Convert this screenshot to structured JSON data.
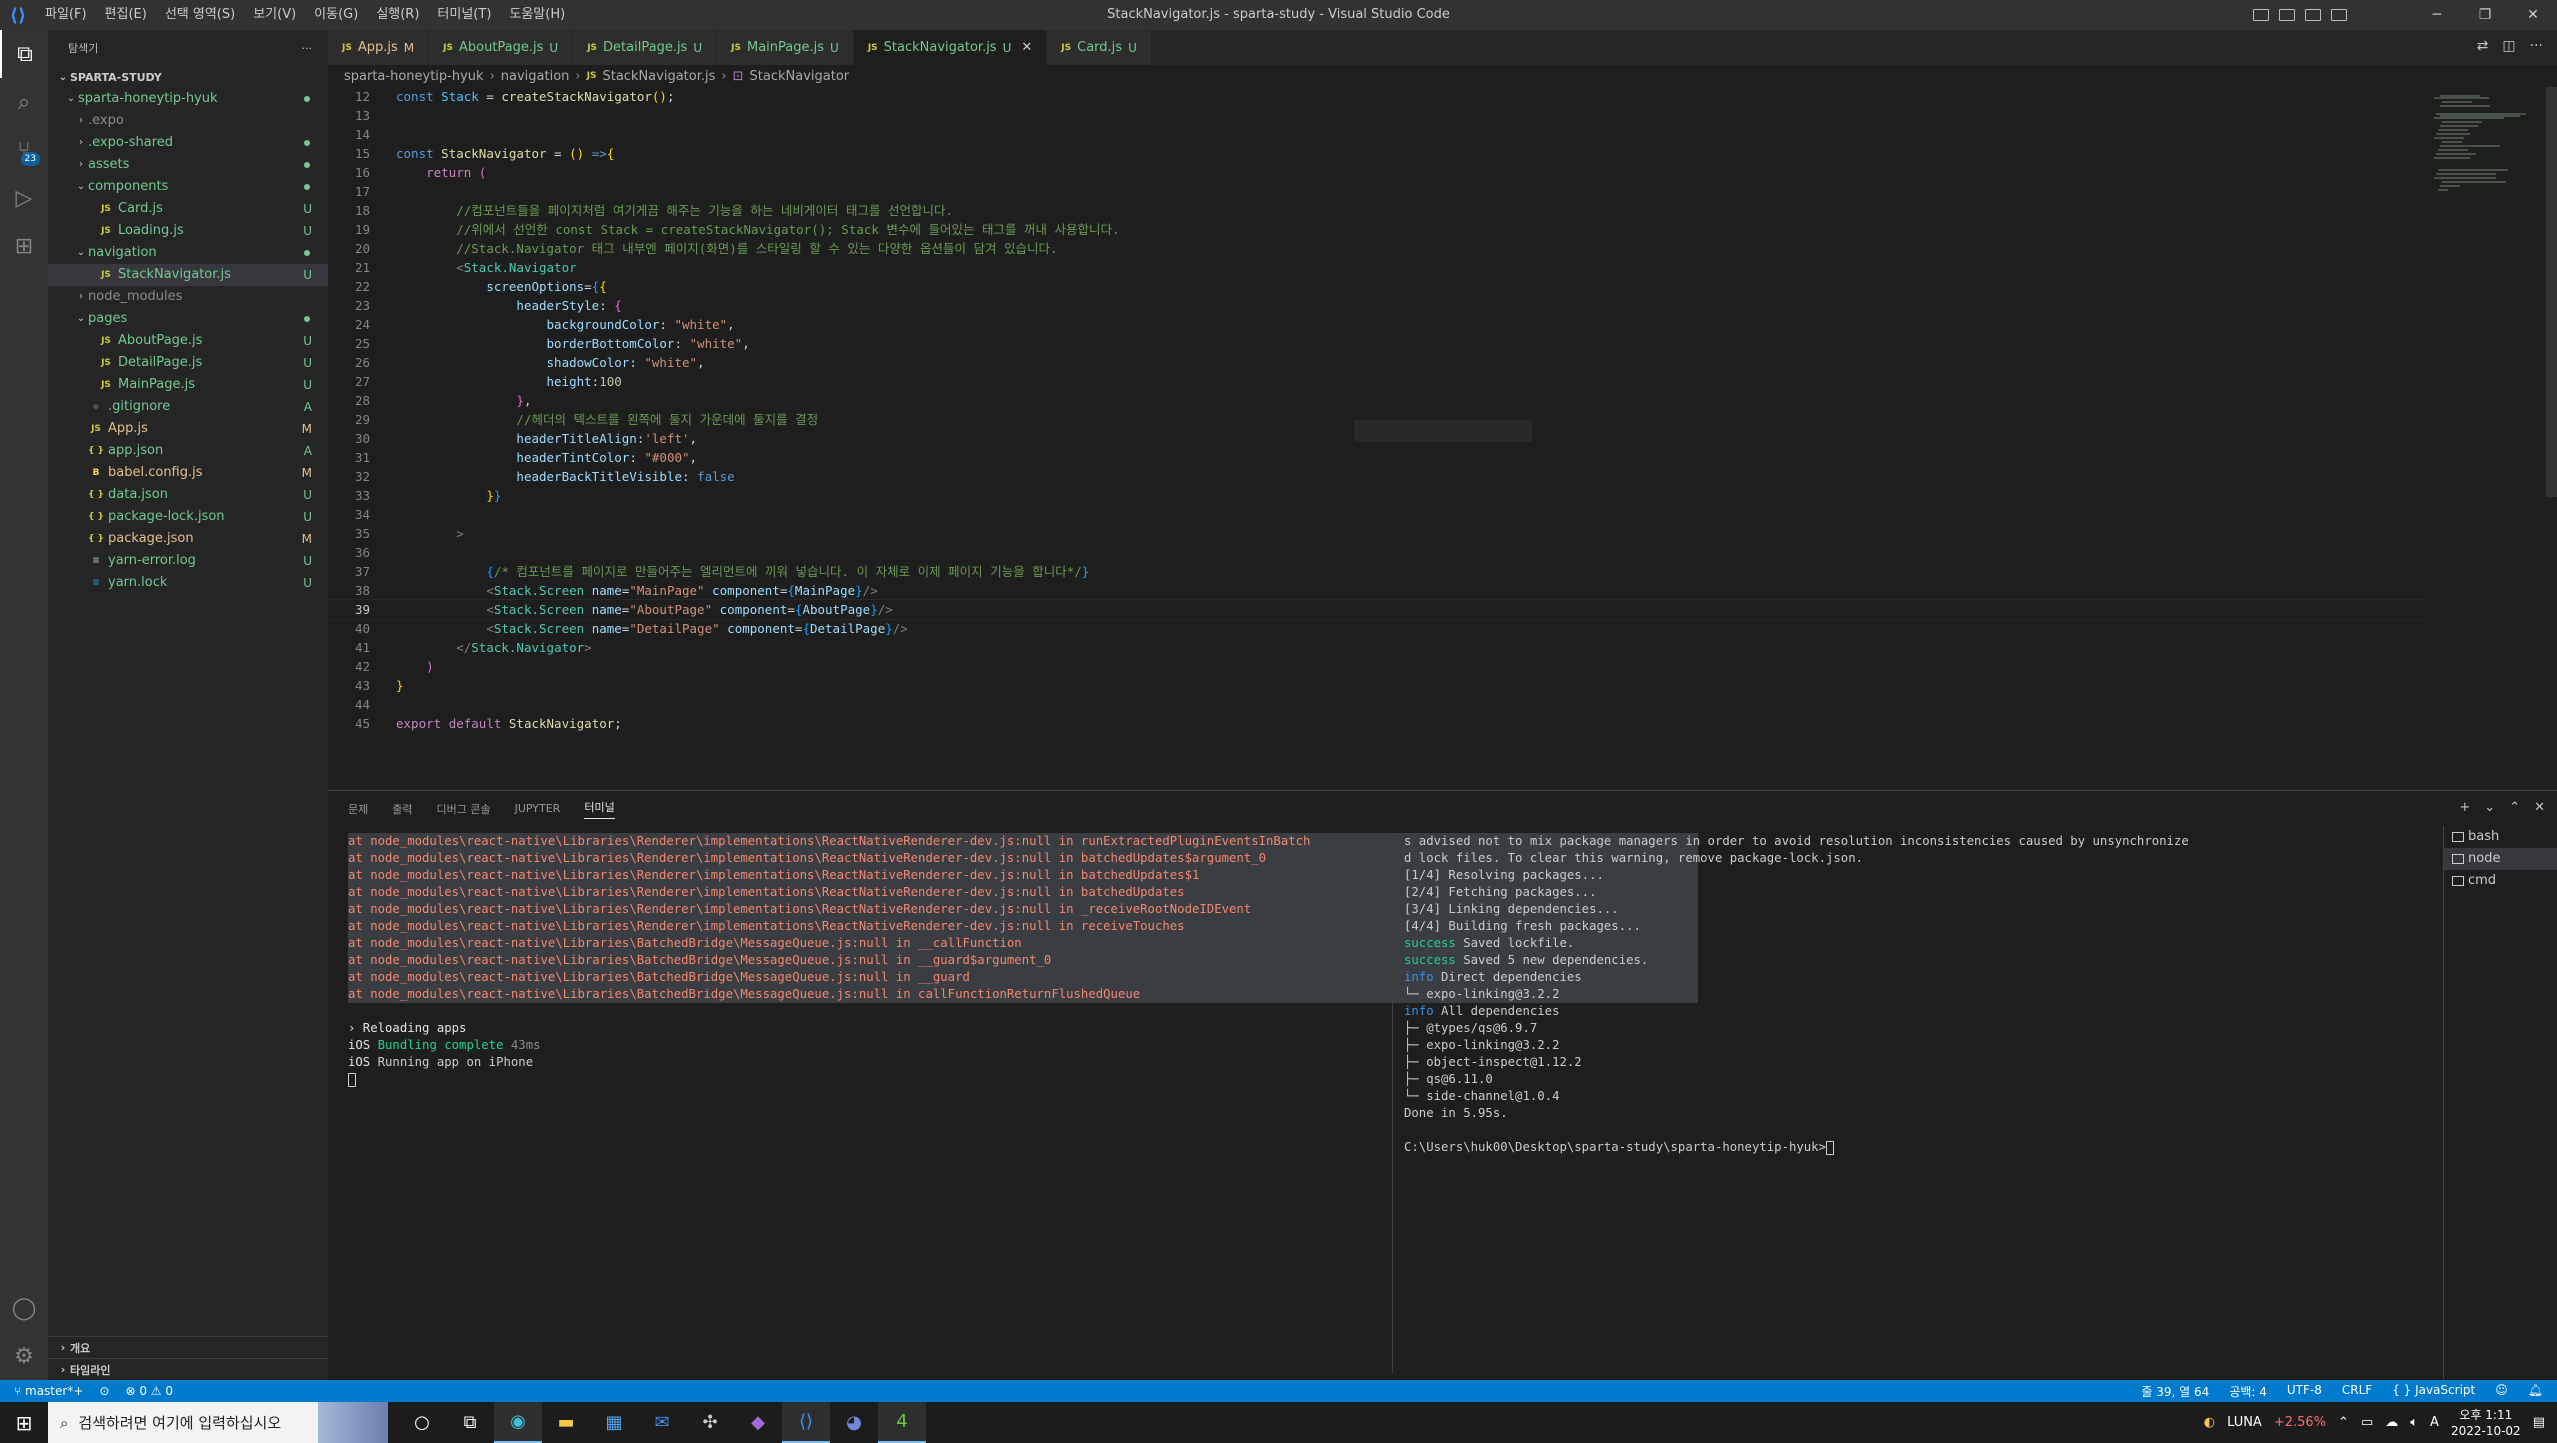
{
  "window": {
    "title": "StackNavigator.js - sparta-study - Visual Studio Code",
    "menu": [
      "파일(F)",
      "편집(E)",
      "선택 영역(S)",
      "보기(V)",
      "이동(G)",
      "실행(R)",
      "터미널(T)",
      "도움말(H)"
    ],
    "controls": {
      "minimize": "─",
      "maximize": "❐",
      "close": "✕"
    }
  },
  "activity_bar": {
    "scm_badge": "23"
  },
  "explorer": {
    "header": "탐색기",
    "more": "···",
    "root": "SPARTA-STUDY",
    "items": [
      {
        "label": "sparta-honeytip-hyuk",
        "chev": "⌄",
        "indent": 1,
        "color": "#73c991",
        "deco": "dot",
        "type": "folder"
      },
      {
        "label": ".expo",
        "chev": "›",
        "indent": 2,
        "color": "#8c8c8c",
        "deco": "",
        "type": "folder"
      },
      {
        "label": ".expo-shared",
        "chev": "›",
        "indent": 2,
        "color": "#73c991",
        "deco": "dot",
        "type": "folder"
      },
      {
        "label": "assets",
        "chev": "›",
        "indent": 2,
        "color": "#73c991",
        "deco": "dot",
        "type": "folder"
      },
      {
        "label": "components",
        "chev": "⌄",
        "indent": 2,
        "color": "#73c991",
        "deco": "dot",
        "type": "folder"
      },
      {
        "label": "Card.js",
        "chev": "",
        "indent": 3,
        "color": "#73c991",
        "deco": "U",
        "type": "js"
      },
      {
        "label": "Loading.js",
        "chev": "",
        "indent": 3,
        "color": "#73c991",
        "deco": "U",
        "type": "js"
      },
      {
        "label": "navigation",
        "chev": "⌄",
        "indent": 2,
        "color": "#73c991",
        "deco": "dot",
        "type": "folder"
      },
      {
        "label": "StackNavigator.js",
        "chev": "",
        "indent": 3,
        "color": "#73c991",
        "deco": "U",
        "type": "js",
        "selected": true
      },
      {
        "label": "node_modules",
        "chev": "›",
        "indent": 2,
        "color": "#8c8c8c",
        "deco": "",
        "type": "folder"
      },
      {
        "label": "pages",
        "chev": "⌄",
        "indent": 2,
        "color": "#73c991",
        "deco": "dot",
        "type": "folder"
      },
      {
        "label": "AboutPage.js",
        "chev": "",
        "indent": 3,
        "color": "#73c991",
        "deco": "U",
        "type": "js"
      },
      {
        "label": "DetailPage.js",
        "chev": "",
        "indent": 3,
        "color": "#73c991",
        "deco": "U",
        "type": "js"
      },
      {
        "label": "MainPage.js",
        "chev": "",
        "indent": 3,
        "color": "#73c991",
        "deco": "U",
        "type": "js"
      },
      {
        "label": ".gitignore",
        "chev": "",
        "indent": 2,
        "color": "#73c991",
        "deco": "A",
        "type": "git"
      },
      {
        "label": "App.js",
        "chev": "",
        "indent": 2,
        "color": "#e2c08d",
        "deco": "M",
        "type": "js"
      },
      {
        "label": "app.json",
        "chev": "",
        "indent": 2,
        "color": "#73c991",
        "deco": "A",
        "type": "json"
      },
      {
        "label": "babel.config.js",
        "chev": "",
        "indent": 2,
        "color": "#e2c08d",
        "deco": "M",
        "type": "babel"
      },
      {
        "label": "data.json",
        "chev": "",
        "indent": 2,
        "color": "#73c991",
        "deco": "U",
        "type": "json"
      },
      {
        "label": "package-lock.json",
        "chev": "",
        "indent": 2,
        "color": "#73c991",
        "deco": "U",
        "type": "json"
      },
      {
        "label": "package.json",
        "chev": "",
        "indent": 2,
        "color": "#e2c08d",
        "deco": "M",
        "type": "json"
      },
      {
        "label": "yarn-error.log",
        "chev": "",
        "indent": 2,
        "color": "#73c991",
        "deco": "U",
        "type": "log"
      },
      {
        "label": "yarn.lock",
        "chev": "",
        "indent": 2,
        "color": "#73c991",
        "deco": "U",
        "type": "yarn"
      }
    ],
    "outline": "개요",
    "timeline": "타임라인"
  },
  "tabs": [
    {
      "label": "App.js",
      "status": "M",
      "active": false,
      "color": "#e2c08d"
    },
    {
      "label": "AboutPage.js",
      "status": "U",
      "active": false,
      "color": "#73c991"
    },
    {
      "label": "DetailPage.js",
      "status": "U",
      "active": false,
      "color": "#73c991"
    },
    {
      "label": "MainPage.js",
      "status": "U",
      "active": false,
      "color": "#73c991"
    },
    {
      "label": "StackNavigator.js",
      "status": "U",
      "active": true,
      "color": "#73c991"
    },
    {
      "label": "Card.js",
      "status": "U",
      "active": false,
      "color": "#73c991"
    }
  ],
  "breadcrumb": [
    "sparta-honeytip-hyuk",
    "navigation",
    "StackNavigator.js",
    "StackNavigator"
  ],
  "editor": {
    "current_line": 39,
    "lines": [
      {
        "n": 12,
        "html": "<span class='k-kw'>const</span> <span class='k-const'>Stack</span> = <span class='k-fn'>createStackNavigator</span><span class='k-y'>()</span>;"
      },
      {
        "n": 13,
        "html": ""
      },
      {
        "n": 14,
        "html": ""
      },
      {
        "n": 15,
        "html": "<span class='k-kw'>const</span> <span class='k-fn'>StackNavigator</span> = <span class='k-y'>()</span> <span class='k-kw'>=&gt;</span><span class='k-y'>{</span>"
      },
      {
        "n": 16,
        "html": "    <span class='k-ctl'>return</span> <span class='k-p'>(</span>"
      },
      {
        "n": 17,
        "html": ""
      },
      {
        "n": 18,
        "html": "        <span class='k-com'>//컴포넌트들을 페이지처럼 여기게끔 해주는 기능을 하는 네비게이터 태그를 선언합니다.</span>"
      },
      {
        "n": 19,
        "html": "        <span class='k-com'>//위에서 선언한 const Stack = createStackNavigator(); Stack 변수에 들어있는 태그를 꺼내 사용합니다.</span>"
      },
      {
        "n": 20,
        "html": "        <span class='k-com'>//Stack.Navigator 태그 내부엔 페이지(화면)를 스타일링 할 수 있는 다양한 옵션들이 담겨 있습니다.</span>"
      },
      {
        "n": 21,
        "html": "        <span class='k-br'>&lt;</span><span class='k-tag'>Stack.Navigator</span>"
      },
      {
        "n": 22,
        "html": "            <span class='k-var'>screenOptions</span>=<span class='k-b'>{</span><span class='k-y'>{</span>"
      },
      {
        "n": 23,
        "html": "                <span class='k-var'>headerStyle</span>: <span class='k-p'>{</span>"
      },
      {
        "n": 24,
        "html": "                    <span class='k-var'>backgroundColor</span>: <span class='k-str'>\"white\"</span>,"
      },
      {
        "n": 25,
        "html": "                    <span class='k-var'>borderBottomColor</span>: <span class='k-str'>\"white\"</span>,"
      },
      {
        "n": 26,
        "html": "                    <span class='k-var'>shadowColor</span>: <span class='k-str'>\"white\"</span>,"
      },
      {
        "n": 27,
        "html": "                    <span class='k-var'>height</span>:<span class='k-num'>100</span>"
      },
      {
        "n": 28,
        "html": "                <span class='k-p'>}</span>,"
      },
      {
        "n": 29,
        "html": "                <span class='k-com'>//헤더의 텍스트를 왼쪽에 둘지 가운데에 둘지를 결정</span>"
      },
      {
        "n": 30,
        "html": "                <span class='k-var'>headerTitleAlign</span>:<span class='k-str'>'left'</span>,"
      },
      {
        "n": 31,
        "html": "                <span class='k-var'>headerTintColor</span>: <span class='k-str'>\"#000\"</span>,"
      },
      {
        "n": 32,
        "html": "                <span class='k-var'>headerBackTitleVisible</span>: <span class='k-kw'>false</span>"
      },
      {
        "n": 33,
        "html": "            <span class='k-y'>}</span><span class='k-b'>}</span>"
      },
      {
        "n": 34,
        "html": ""
      },
      {
        "n": 35,
        "html": "        <span class='k-br'>&gt;</span>"
      },
      {
        "n": 36,
        "html": ""
      },
      {
        "n": 37,
        "html": "            <span class='k-b'>{</span><span class='k-com'>/* 컴포넌트를 페이지로 만들어주는 엘리먼트에 끼워 넣습니다. 이 자체로 이제 페이지 기능을 합니다*/</span><span class='k-b'>}</span>"
      },
      {
        "n": 38,
        "html": "            <span class='k-br'>&lt;</span><span class='k-tag'>Stack.Screen</span> <span class='k-var'>name</span>=<span class='k-str'>\"MainPage\"</span> <span class='k-var'>component</span>=<span class='k-b'>{</span><span class='k-var'>MainPage</span><span class='k-b'>}</span><span class='k-br'>/&gt;</span>"
      },
      {
        "n": 39,
        "html": "            <span class='k-br'>&lt;</span><span class='k-tag'>Stack.Screen</span> <span class='k-var'>name</span>=<span class='k-str'>\"AboutPage\"</span> <span class='k-var'>component</span>=<span class='k-b'>{</span><span class='k-var'>AboutPage</span><span class='k-b'>}</span><span class='k-br'>/&gt;</span>"
      },
      {
        "n": 40,
        "html": "            <span class='k-br'>&lt;</span><span class='k-tag'>Stack.Screen</span> <span class='k-var'>name</span>=<span class='k-str'>\"DetailPage\"</span> <span class='k-var'>component</span>=<span class='k-b'>{</span><span class='k-var'>DetailPage</span><span class='k-b'>}</span><span class='k-br'>/&gt;</span>"
      },
      {
        "n": 41,
        "html": "        <span class='k-br'>&lt;/</span><span class='k-tag'>Stack.Navigator</span><span class='k-br'>&gt;</span>"
      },
      {
        "n": 42,
        "html": "    <span class='k-p'>)</span>"
      },
      {
        "n": 43,
        "html": "<span class='k-y'>}</span>"
      },
      {
        "n": 44,
        "html": ""
      },
      {
        "n": 45,
        "html": "<span class='k-ctl'>export</span> <span class='k-ctl'>default</span> <span class='k-fn'>StackNavigator</span>;"
      }
    ]
  },
  "panel": {
    "tabs": [
      "문제",
      "출력",
      "디버그 콘솔",
      "JUPYTER",
      "터미널"
    ],
    "active_tab": "터미널",
    "actions": [
      "+",
      "⌄",
      "⌃",
      "✕"
    ],
    "terminal_left": {
      "errors": [
        "at node_modules\\react-native\\Libraries\\Renderer\\implementations\\ReactNativeRenderer-dev.js:null in runExtractedPluginEventsInBatch",
        "at node_modules\\react-native\\Libraries\\Renderer\\implementations\\ReactNativeRenderer-dev.js:null in batchedUpdates$argument_0",
        "at node_modules\\react-native\\Libraries\\Renderer\\implementations\\ReactNativeRenderer-dev.js:null in batchedUpdates$1",
        "at node_modules\\react-native\\Libraries\\Renderer\\implementations\\ReactNativeRenderer-dev.js:null in batchedUpdates",
        "at node_modules\\react-native\\Libraries\\Renderer\\implementations\\ReactNativeRenderer-dev.js:null in _receiveRootNodeIDEvent",
        "at node_modules\\react-native\\Libraries\\Renderer\\implementations\\ReactNativeRenderer-dev.js:null in receiveTouches",
        "at node_modules\\react-native\\Libraries\\BatchedBridge\\MessageQueue.js:null in __callFunction",
        "at node_modules\\react-native\\Libraries\\BatchedBridge\\MessageQueue.js:null in __guard$argument_0",
        "at node_modules\\react-native\\Libraries\\BatchedBridge\\MessageQueue.js:null in __guard",
        "at node_modules\\react-native\\Libraries\\BatchedBridge\\MessageQueue.js:null in callFunctionReturnFlushedQueue"
      ],
      "reload": "› Reloading apps",
      "bundling_prefix": "iOS",
      "bundling_text": "Bundling complete",
      "bundling_time": "43ms",
      "running_prefix": "iOS",
      "running_text": "Running app on iPhone"
    },
    "terminal_right": {
      "warn1": "s advised not to mix package managers in order to avoid resolution inconsistencies caused by unsynchronize",
      "warn2": "d lock files. To clear this warning, remove package-lock.json.",
      "steps": [
        "[1/4] Resolving packages...",
        "[2/4] Fetching packages...",
        "[3/4] Linking dependencies...",
        "[4/4] Building fresh packages..."
      ],
      "success1_tag": "success",
      "success1": "Saved lockfile.",
      "success2_tag": "success",
      "success2": "Saved 5 new dependencies.",
      "info1_tag": "info",
      "info1": "Direct dependencies",
      "direct": [
        "└─ expo-linking@3.2.2"
      ],
      "info2_tag": "info",
      "info2": "All dependencies",
      "all": [
        "├─ @types/qs@6.9.7",
        "├─ expo-linking@3.2.2",
        "├─ object-inspect@1.12.2",
        "├─ qs@6.11.0",
        "└─ side-channel@1.0.4"
      ],
      "done": "Done in 5.95s.",
      "prompt": "C:\\Users\\huk00\\Desktop\\sparta-study\\sparta-honeytip-hyuk>"
    },
    "terminals": [
      "bash",
      "node",
      "cmd"
    ]
  },
  "statusbar": {
    "branch": "master*+",
    "sync": "⊙",
    "problems": "⊗ 0 ⚠ 0",
    "position": "줄 39, 열 64",
    "spaces": "공백: 4",
    "encoding": "UTF-8",
    "eol": "CRLF",
    "language": "{ } JavaScript"
  },
  "taskbar": {
    "search_placeholder": "검색하려면 여기에 입력하십시오",
    "stock_name": "LUNA",
    "stock_change": "+2.56%",
    "time": "오후 1:11",
    "date": "2022-10-02"
  },
  "colors": {
    "accent": "#007acc",
    "modified": "#e2c08d",
    "untracked": "#73c991",
    "error": "#f48771"
  }
}
